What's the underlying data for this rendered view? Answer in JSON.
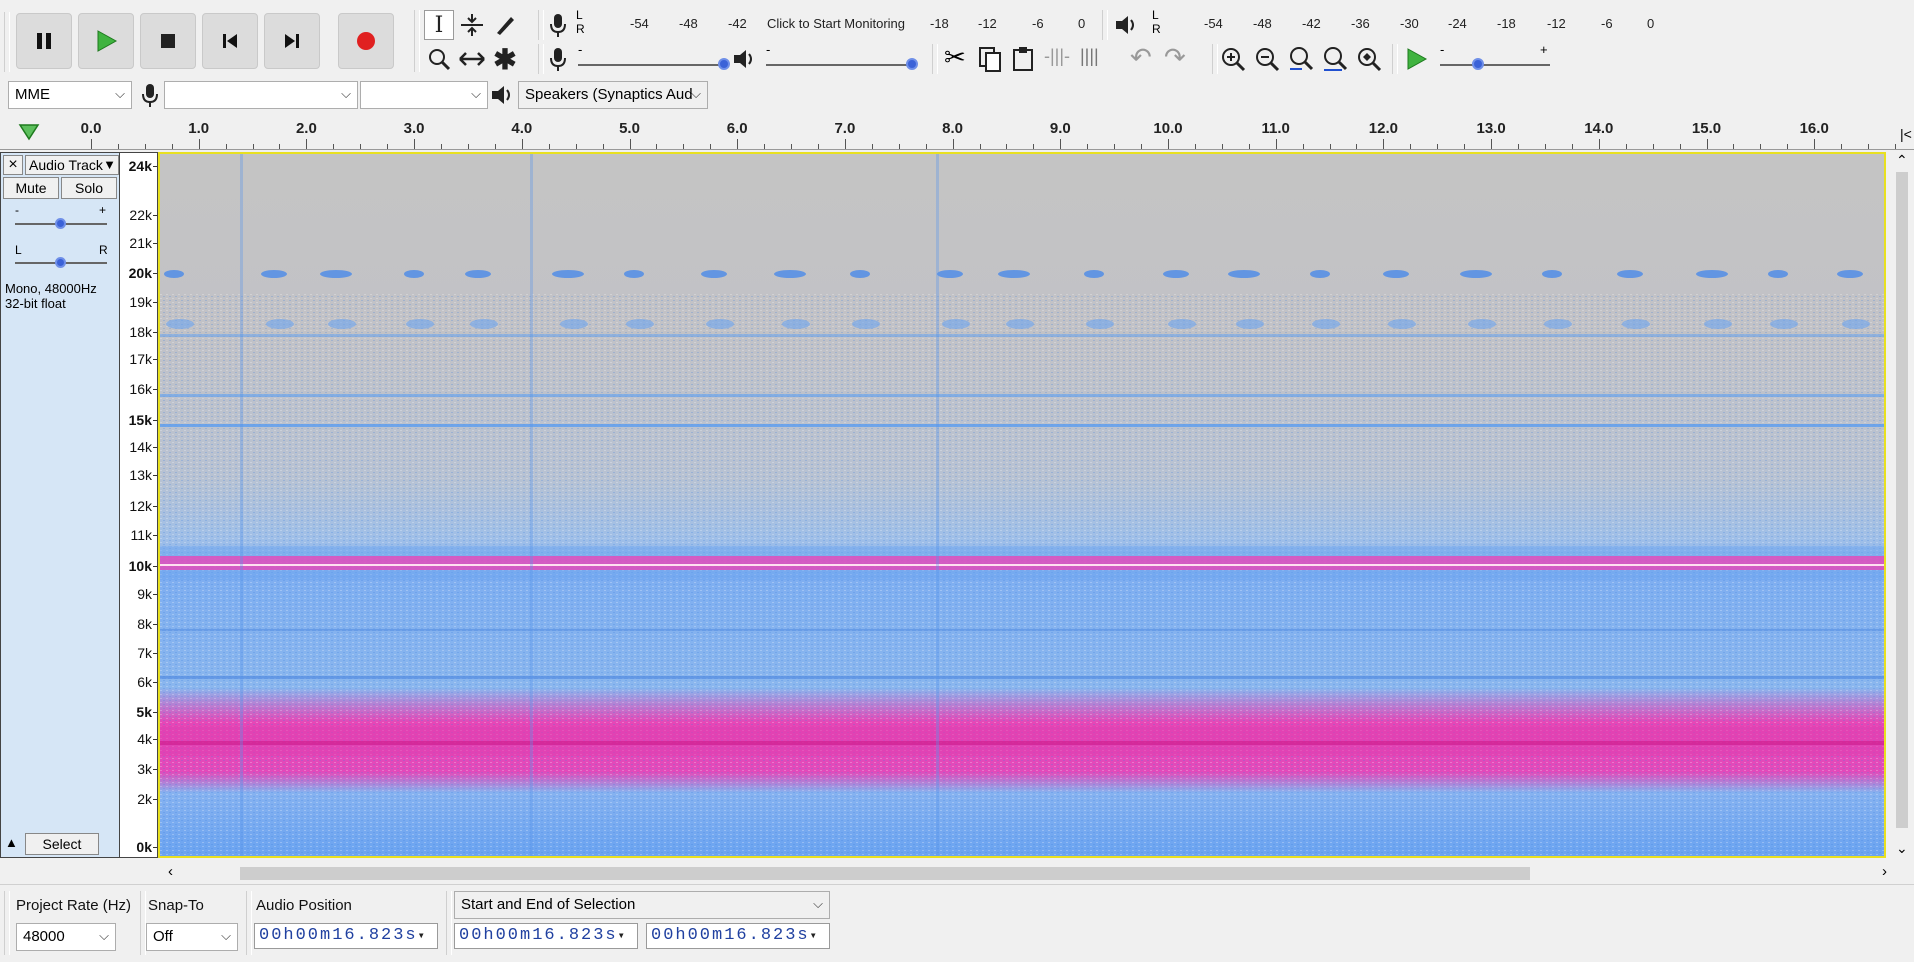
{
  "transport": {
    "pause_icon": "pause-icon",
    "play_icon": "play-icon",
    "stop_icon": "stop-icon",
    "skip_start_icon": "skip-to-start-icon",
    "skip_end_icon": "skip-to-end-icon",
    "record_icon": "record-icon",
    "record_color": "#e02020",
    "play_color": "#2aa02a"
  },
  "tools": [
    "selection-tool-icon",
    "envelope-tool-icon",
    "draw-tool-icon",
    "zoom-tool-icon",
    "time-shift-tool-icon",
    "multi-tool-icon"
  ],
  "rec_meter": {
    "ticks": [
      "-54",
      "-48",
      "-42",
      "-18",
      "-12",
      "-6",
      "0"
    ],
    "monitor_text": "Click to Start Monitoring",
    "lr": [
      "L",
      "R"
    ]
  },
  "play_meter": {
    "ticks": [
      "-54",
      "-48",
      "-42",
      "-36",
      "-30",
      "-24",
      "-18",
      "-12",
      "-6",
      "0"
    ],
    "lr": [
      "L",
      "R"
    ]
  },
  "mixer": {
    "minus": "-",
    "plus": "+"
  },
  "device": {
    "host": "MME",
    "rec_device": "",
    "rec_channels": "",
    "playback_device": "Speakers (Synaptics Aud"
  },
  "ruler": {
    "labels": [
      "0.0",
      "1.0",
      "2.0",
      "3.0",
      "4.0",
      "5.0",
      "6.0",
      "7.0",
      "8.0",
      "9.0",
      "10.0",
      "11.0",
      "12.0",
      "13.0",
      "14.0",
      "15.0",
      "16.0"
    ]
  },
  "track": {
    "name": "Audio Track",
    "close": "×",
    "mute": "Mute",
    "solo": "Solo",
    "gain_minus": "-",
    "gain_plus": "+",
    "pan_l": "L",
    "pan_r": "R",
    "info1": "Mono, 48000Hz",
    "info2": "32-bit float",
    "select": "Select",
    "gain": 0.5,
    "pan": 0.5
  },
  "freq_scale": [
    {
      "t": "24k",
      "b": true
    },
    {
      "t": "22k"
    },
    {
      "t": "21k"
    },
    {
      "t": "20k",
      "b": true
    },
    {
      "t": "19k"
    },
    {
      "t": "18k"
    },
    {
      "t": "17k"
    },
    {
      "t": "16k"
    },
    {
      "t": "15k",
      "b": true
    },
    {
      "t": "14k"
    },
    {
      "t": "13k"
    },
    {
      "t": "12k"
    },
    {
      "t": "11k"
    },
    {
      "t": "10k",
      "b": true
    },
    {
      "t": "9k"
    },
    {
      "t": "8k"
    },
    {
      "t": "7k"
    },
    {
      "t": "6k"
    },
    {
      "t": "5k",
      "b": true
    },
    {
      "t": "4k"
    },
    {
      "t": "3k"
    },
    {
      "t": "2k"
    },
    {
      "t": "0k",
      "b": true
    }
  ],
  "bottom": {
    "project_rate_label": "Project Rate (Hz)",
    "project_rate": "48000",
    "snap_label": "Snap-To",
    "snap": "Off",
    "audio_pos_label": "Audio Position",
    "audio_pos": "00h00m16.823s",
    "selection_label": "Start and End of Selection",
    "sel_start": "00h00m16.823s",
    "sel_end": "00h00m16.823s"
  },
  "colors": {
    "spec_bg": "#c4c4c4",
    "spec_blue": "#6aa3f0",
    "spec_magenta": "#f040b0",
    "track_panel": "#d6e6f6",
    "selected_border": "#e8e020"
  }
}
